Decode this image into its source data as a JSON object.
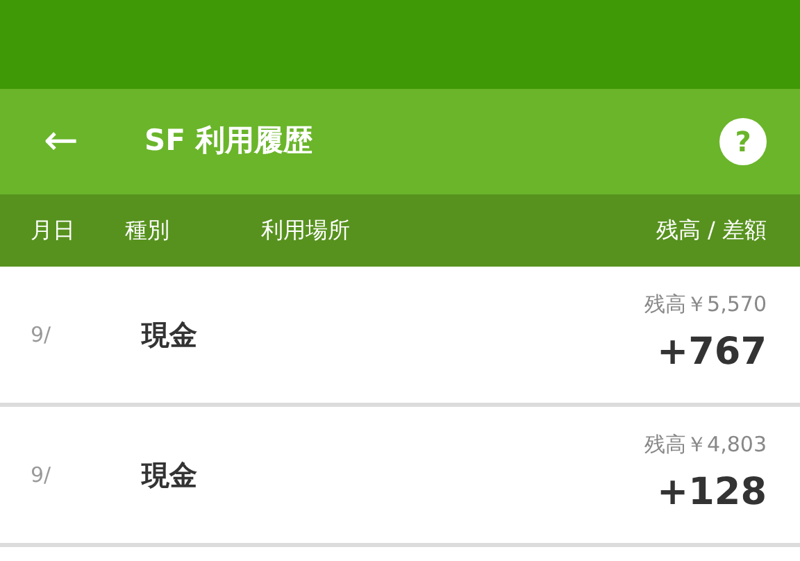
{
  "toolbar": {
    "back": "←",
    "title": "SF 利用履歴",
    "help": "?"
  },
  "columns": [
    "月日",
    "種別",
    "利用場所",
    "残高 / 差額"
  ],
  "rows": [
    {
      "date": "9/",
      "type": "現金",
      "balance": "残高￥5,570",
      "amount": "+767"
    },
    {
      "date": "9/",
      "type": "現金",
      "balance": "残高￥4,803",
      "amount": "+128"
    }
  ]
}
